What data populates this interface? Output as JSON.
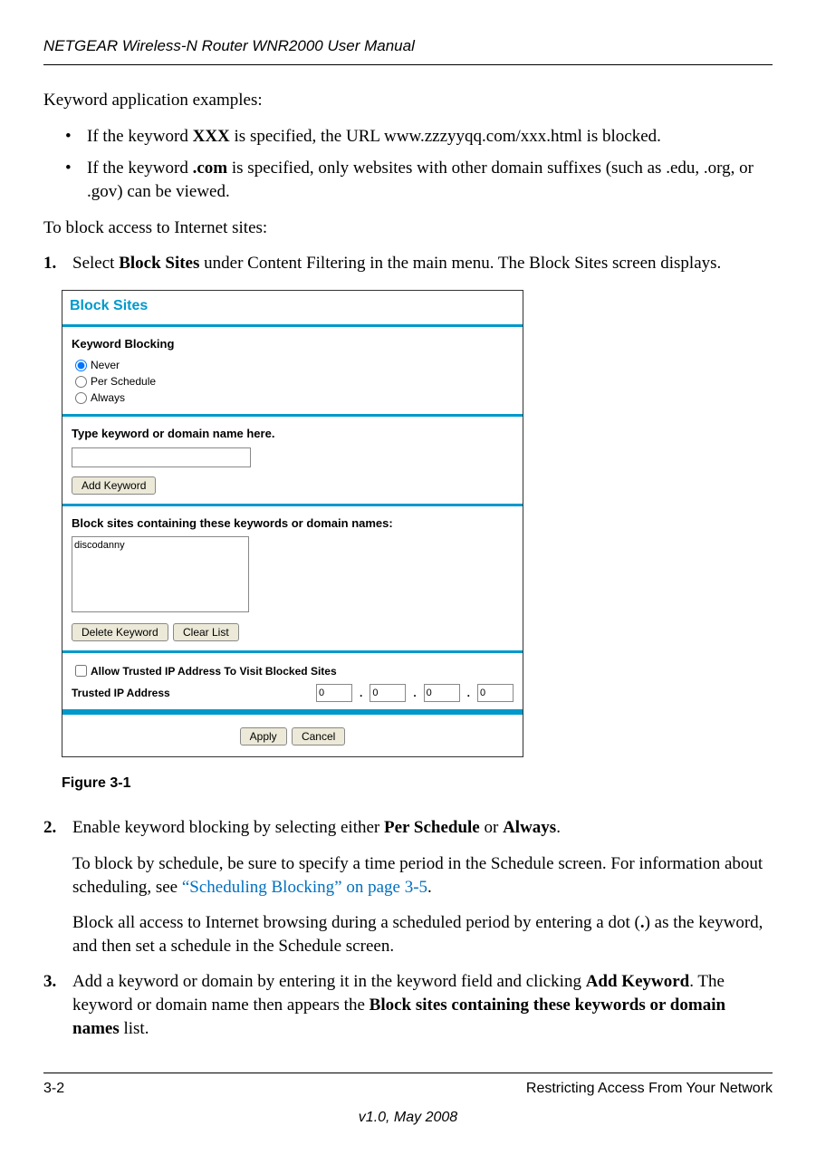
{
  "header": "NETGEAR Wireless-N Router WNR2000 User Manual",
  "intro": "Keyword application examples:",
  "bullets": [
    {
      "pre": "If the keyword ",
      "bold": "XXX",
      "post": " is specified, the URL www.zzzyyqq.com/xxx.html is blocked."
    },
    {
      "pre": "If the keyword ",
      "bold": ".com",
      "post": " is specified, only websites with other domain suffixes (such as .edu, .org, or .gov) can be viewed."
    }
  ],
  "lead2": "To block access to Internet sites:",
  "step1": {
    "num": "1.",
    "pre": "Select ",
    "bold": "Block Sites",
    "post": " under Content Filtering in the main menu. The Block Sites screen displays."
  },
  "figure": {
    "title": "Block Sites",
    "kb_label": "Keyword Blocking",
    "radios": [
      "Never",
      "Per Schedule",
      "Always"
    ],
    "type_label": "Type keyword or domain name here.",
    "add_btn": "Add Keyword",
    "list_label": "Block sites containing these keywords or domain names:",
    "list_item": "discodanny",
    "del_btn": "Delete Keyword",
    "clr_btn": "Clear List",
    "trust_check": "Allow Trusted IP Address To Visit Blocked Sites",
    "trust_label": "Trusted IP Address",
    "ip": [
      "0",
      "0",
      "0",
      "0"
    ],
    "apply": "Apply",
    "cancel": "Cancel",
    "caption": "Figure 3-1"
  },
  "step2": {
    "num": "2.",
    "line1_pre": "Enable keyword blocking by selecting either ",
    "line1_b1": "Per Schedule",
    "line1_mid": " or ",
    "line1_b2": "Always",
    "line1_post": ".",
    "line2_pre": "To block by schedule, be sure to specify a time period in the Schedule screen. For information about scheduling, see ",
    "line2_link": "“Scheduling Blocking” on page 3-5",
    "line2_post": ".",
    "line3_pre": "Block all access to Internet browsing during a scheduled period by entering a dot (",
    "line3_b": ".",
    "line3_post": ") as the keyword, and then set a schedule in the Schedule screen."
  },
  "step3": {
    "num": "3.",
    "pre": "Add a keyword or domain by entering it in the keyword field and clicking ",
    "b1": "Add Keyword",
    "mid": ". The keyword or domain name then appears the ",
    "b2": "Block sites containing these keywords or domain names",
    "post": " list."
  },
  "footer": {
    "left": "3-2",
    "right": "Restricting Access From Your Network",
    "version": "v1.0, May 2008"
  }
}
